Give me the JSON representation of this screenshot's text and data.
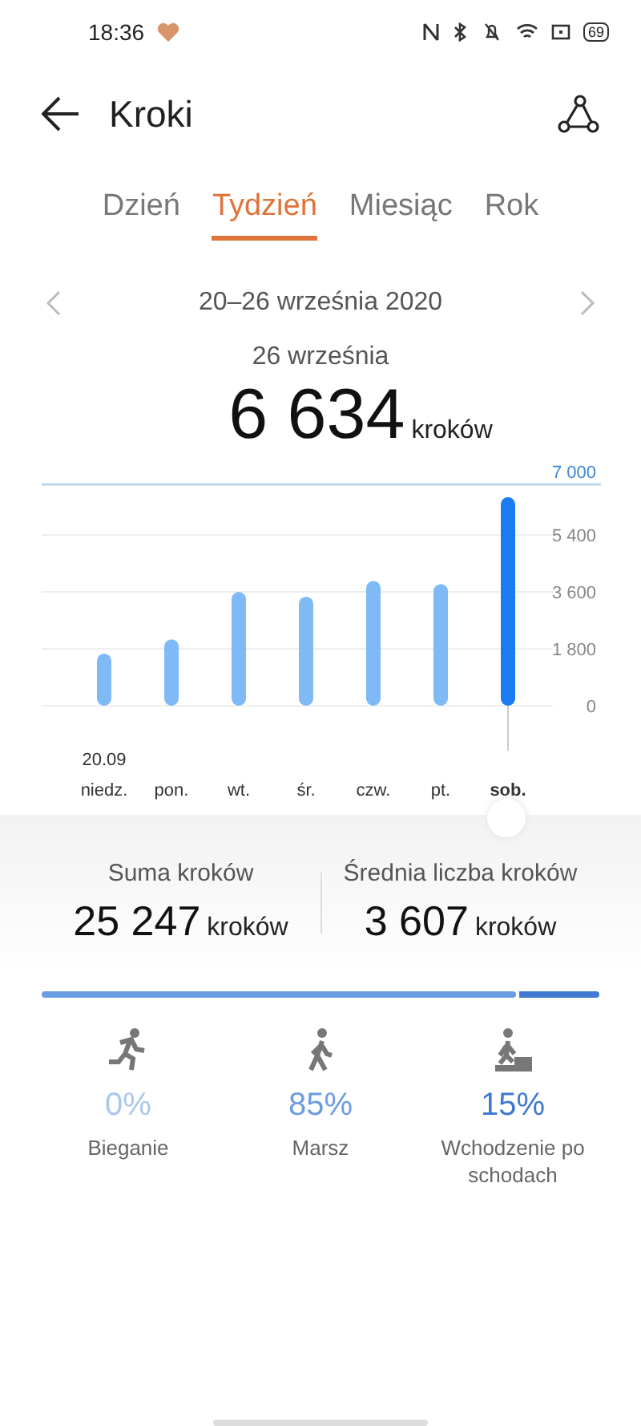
{
  "status_bar": {
    "time": "18:36",
    "battery": "69"
  },
  "header": {
    "title": "Kroki"
  },
  "tabs": [
    {
      "label": "Dzień",
      "selected": false
    },
    {
      "label": "Tydzień",
      "selected": true
    },
    {
      "label": "Miesiąc",
      "selected": false
    },
    {
      "label": "Rok",
      "selected": false
    }
  ],
  "period": {
    "label": "20–26 września 2020"
  },
  "selected_day": {
    "date": "26 września",
    "value": "6 634",
    "unit": "kroków"
  },
  "chart": {
    "days": [
      {
        "selected": false
      },
      {
        "selected": false
      },
      {
        "selected": false
      },
      {
        "selected": false
      },
      {
        "selected": false
      },
      {
        "selected": false
      },
      {
        "selected": true
      }
    ],
    "first_date": "20.09",
    "chart_data": {
      "type": "bar",
      "grid": true,
      "categories": [
        "niedz.",
        "pon.",
        "wt.",
        "śr.",
        "czw.",
        "pt.",
        "sob."
      ],
      "series": [
        {
          "color": "#7fbaf7",
          "values": [
            1650,
            2100,
            3600,
            3450,
            3950,
            3850,
            null
          ]
        },
        {
          "color": "#1a7cf0",
          "values": [
            null,
            null,
            null,
            null,
            null,
            null,
            6600
          ]
        }
      ],
      "ylim": [
        0,
        7000
      ],
      "yticks": [
        {
          "value": 0,
          "label": "0"
        },
        {
          "value": 1800,
          "label": "1 800"
        },
        {
          "value": 3600,
          "label": "3 600"
        },
        {
          "value": 5400,
          "label": "5 400"
        },
        {
          "value": 7000,
          "label": "7 000"
        }
      ]
    }
  },
  "summary": [
    {
      "label": "Suma kroków",
      "value": "25 247",
      "unit": "kroków"
    },
    {
      "label": "Średnia liczba kroków",
      "value": "3 607",
      "unit": "kroków"
    }
  ],
  "activities": [
    {
      "kind": "run",
      "percent": "0%",
      "label": "Bieganie",
      "color": "#a9c8f0"
    },
    {
      "kind": "walk",
      "percent": "85%",
      "label": "Marsz",
      "color": "#6b9de3"
    },
    {
      "kind": "stairs",
      "percent": "15%",
      "label": "Wchodzenie po schodach",
      "color": "#3f79d2"
    }
  ]
}
